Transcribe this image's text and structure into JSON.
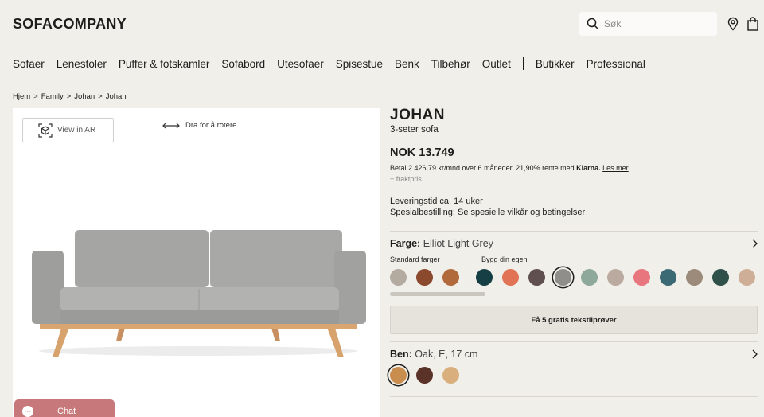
{
  "header": {
    "logo": "SOFACOMPANY",
    "search_placeholder": "Søk"
  },
  "nav": {
    "items": [
      "Sofaer",
      "Lenestoler",
      "Puffer & fotskamler",
      "Sofabord",
      "Utesofaer",
      "Spisestue",
      "Benk",
      "Tilbehør",
      "Outlet"
    ],
    "items_right": [
      "Butikker",
      "Professional"
    ]
  },
  "breadcrumb": [
    "Hjem",
    ">",
    "Family",
    ">",
    "Johan",
    ">",
    "Johan"
  ],
  "viewer": {
    "ar_label": "View in AR",
    "rotate_hint": "Dra for å rotere"
  },
  "chat": {
    "label": "Chat"
  },
  "product": {
    "title": "JOHAN",
    "subtitle": "3-seter sofa",
    "price": "NOK 13.749",
    "klarna_text": "Betal 2 426,79 kr/mnd over 6 måneder, 21,90% rente med ",
    "klarna_brand": "Klarna.",
    "klarna_link": "Les mer",
    "freight": "+ fraktpris",
    "delivery": "Leveringstid ca. 14 uker",
    "special_label": "Spesialbestilling:",
    "special_link": "Se spesielle vilkår og betingelser"
  },
  "color_option": {
    "label": "Farge:",
    "value": "Elliot Light Grey",
    "standard_label": "Standard farger",
    "custom_label": "Bygg din egen",
    "standard_colors": [
      "#b3aaa0",
      "#8b4a2e",
      "#b06a3b"
    ],
    "custom_colors": [
      "#163f45",
      "#e07455",
      "#5f4f4e",
      "#8f8e8a",
      "#8fa89c",
      "#bbaa9f",
      "#e8767e",
      "#3c6a74",
      "#9c8b7a",
      "#2f514a",
      "#cfae97"
    ],
    "selected_index": 3,
    "scroll_fraction": 0.26
  },
  "samples_button": "Få 5 gratis tekstilprøver",
  "leg_option": {
    "label": "Ben:",
    "value": "Oak, E, 17 cm",
    "colors": [
      "#c98d4e",
      "#5a3228",
      "#d9b07d"
    ],
    "selected_index": 0
  }
}
